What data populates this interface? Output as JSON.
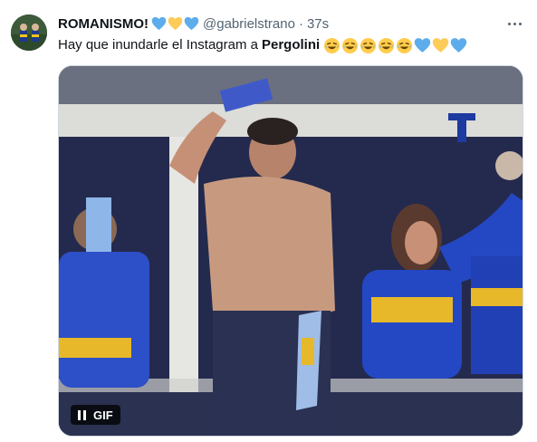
{
  "tweet": {
    "author_name": "ROMANISMO!",
    "handle": "@gabrielstrano",
    "separator": "·",
    "time": "37s",
    "text_prefix": "Hay que inundarle el Instagram a",
    "mention": "Pergolini",
    "laugh_emoji_count": 5,
    "heart_sequence": [
      "blue",
      "yellow",
      "blue"
    ]
  },
  "media": {
    "gif_label": "GIF"
  },
  "colors": {
    "blue_heart": "#5dadec",
    "yellow_heart": "#fdcb58",
    "text": "#0f1419",
    "muted": "#536471"
  }
}
